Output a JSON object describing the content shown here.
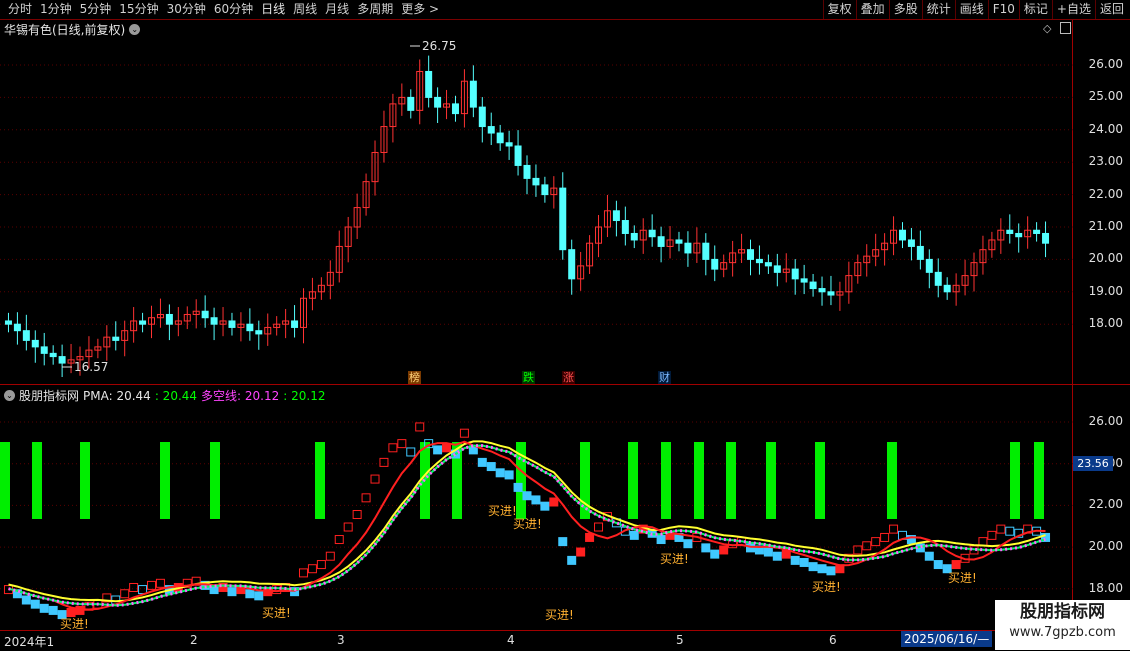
{
  "toolbar": {
    "periods": [
      "分时",
      "1分钟",
      "5分钟",
      "15分钟",
      "30分钟",
      "60分钟",
      "日线",
      "周线",
      "月线",
      "多周期",
      "更多 >"
    ],
    "active_period": "日线",
    "actions": [
      "复权",
      "叠加",
      "多股",
      "统计",
      "画线",
      "F10",
      "标记",
      "+自选",
      "返回"
    ]
  },
  "main_pane": {
    "title": "华锡有色(日线,前复权)",
    "high_label": "26.75",
    "low_label": "16.57",
    "y_ticks": [
      "26.00",
      "25.00",
      "24.00",
      "23.00",
      "22.00",
      "21.00",
      "20.00",
      "19.00",
      "18.00"
    ],
    "tags": [
      {
        "text": "榜",
        "color": "#ffd27a",
        "bg": "#7a3a00"
      },
      {
        "text": "跌",
        "color": "#00ff00",
        "bg": "#003300"
      },
      {
        "text": "涨",
        "color": "#ff5050",
        "bg": "#3a0000"
      },
      {
        "text": "财",
        "color": "#7ab8ff",
        "bg": "#001a3a"
      }
    ]
  },
  "indicator_pane": {
    "name": "股朋指标网",
    "pma_label": "PMA: 20.44",
    "pma_value": ": 20.44",
    "dkx_label": "多空线: 20.12",
    "dkx_value": ": 20.12",
    "y_ticks": [
      "26.00",
      "24.00",
      "22.00",
      "20.00",
      "18.00"
    ],
    "current_price": "23.56",
    "buy_signals": [
      "买进!",
      "买进!",
      "买进!",
      "买进!",
      "买进!",
      "买进!",
      "买进!",
      "买进!"
    ]
  },
  "date_axis": {
    "labels": [
      "2024年1",
      "2",
      "3",
      "4",
      "5",
      "6"
    ],
    "cursor_date": "2025/06/16/—"
  },
  "watermark": {
    "line1": "股朋指标网",
    "line2": "www.7gpzb.com"
  },
  "chart_data": {
    "type": "candlestick",
    "series_name": "华锡有色 日K",
    "ylim": [
      17.0,
      27.0
    ],
    "closes": [
      18.0,
      17.8,
      17.5,
      17.3,
      17.1,
      17.0,
      16.8,
      16.9,
      17.0,
      17.2,
      17.3,
      17.6,
      17.5,
      17.8,
      18.1,
      18.0,
      18.2,
      18.3,
      18.0,
      18.1,
      18.3,
      18.4,
      18.2,
      18.0,
      18.1,
      17.9,
      18.0,
      17.8,
      17.7,
      17.9,
      18.0,
      18.1,
      17.9,
      18.8,
      19.0,
      19.2,
      19.6,
      20.4,
      21.0,
      21.6,
      22.4,
      23.3,
      24.1,
      24.8,
      25.0,
      24.6,
      25.8,
      25.0,
      24.7,
      24.8,
      24.5,
      25.5,
      24.7,
      24.1,
      23.9,
      23.6,
      23.5,
      22.9,
      22.5,
      22.3,
      22.0,
      22.2,
      20.3,
      19.4,
      19.8,
      20.5,
      21.0,
      21.5,
      21.2,
      20.8,
      20.6,
      20.9,
      20.7,
      20.4,
      20.6,
      20.5,
      20.2,
      20.5,
      20.0,
      19.7,
      19.9,
      20.2,
      20.3,
      20.0,
      19.9,
      19.8,
      19.6,
      19.7,
      19.4,
      19.3,
      19.1,
      19.0,
      18.9,
      19.0,
      19.5,
      19.9,
      20.1,
      20.3,
      20.5,
      20.9,
      20.6,
      20.4,
      20.0,
      19.6,
      19.2,
      19.0,
      19.2,
      19.5,
      19.9,
      20.3,
      20.6,
      20.9,
      20.8,
      20.7,
      20.9,
      20.8,
      20.5
    ],
    "indicator_last": {
      "PMA": 20.44,
      "DKX": 20.12
    }
  }
}
